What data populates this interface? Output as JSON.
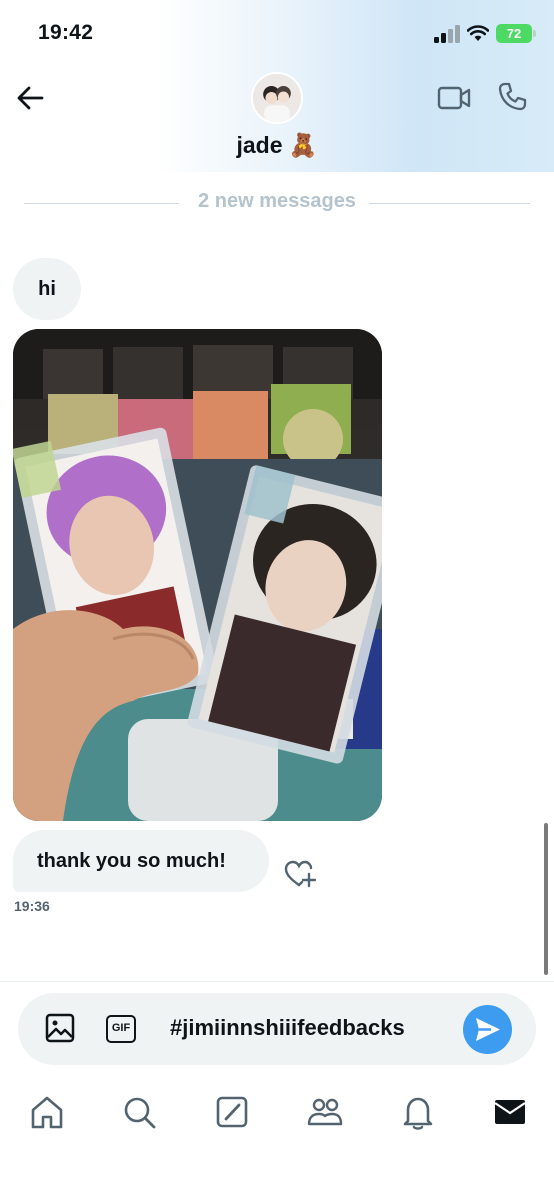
{
  "status_bar": {
    "time": "19:42",
    "battery": "72"
  },
  "header": {
    "contact_name": "jade 🧸"
  },
  "divider": {
    "label": "2 new messages"
  },
  "messages": [
    {
      "text": "hi"
    },
    {
      "text": "thank you so much!",
      "time": "19:36"
    }
  ],
  "composer": {
    "text": "#jimiinnshiiifeedbacks",
    "gif_label": "GIF"
  },
  "colors": {
    "accent": "#3d9bf0",
    "bubble": "#eff3f4",
    "muted": "#536471"
  },
  "icons": [
    "back-arrow-icon",
    "video-call-icon",
    "phone-icon",
    "heart-plus-icon",
    "image-icon",
    "gif-icon",
    "send-icon",
    "home-icon",
    "search-icon",
    "grok-icon",
    "communities-icon",
    "bell-icon",
    "mail-icon"
  ]
}
